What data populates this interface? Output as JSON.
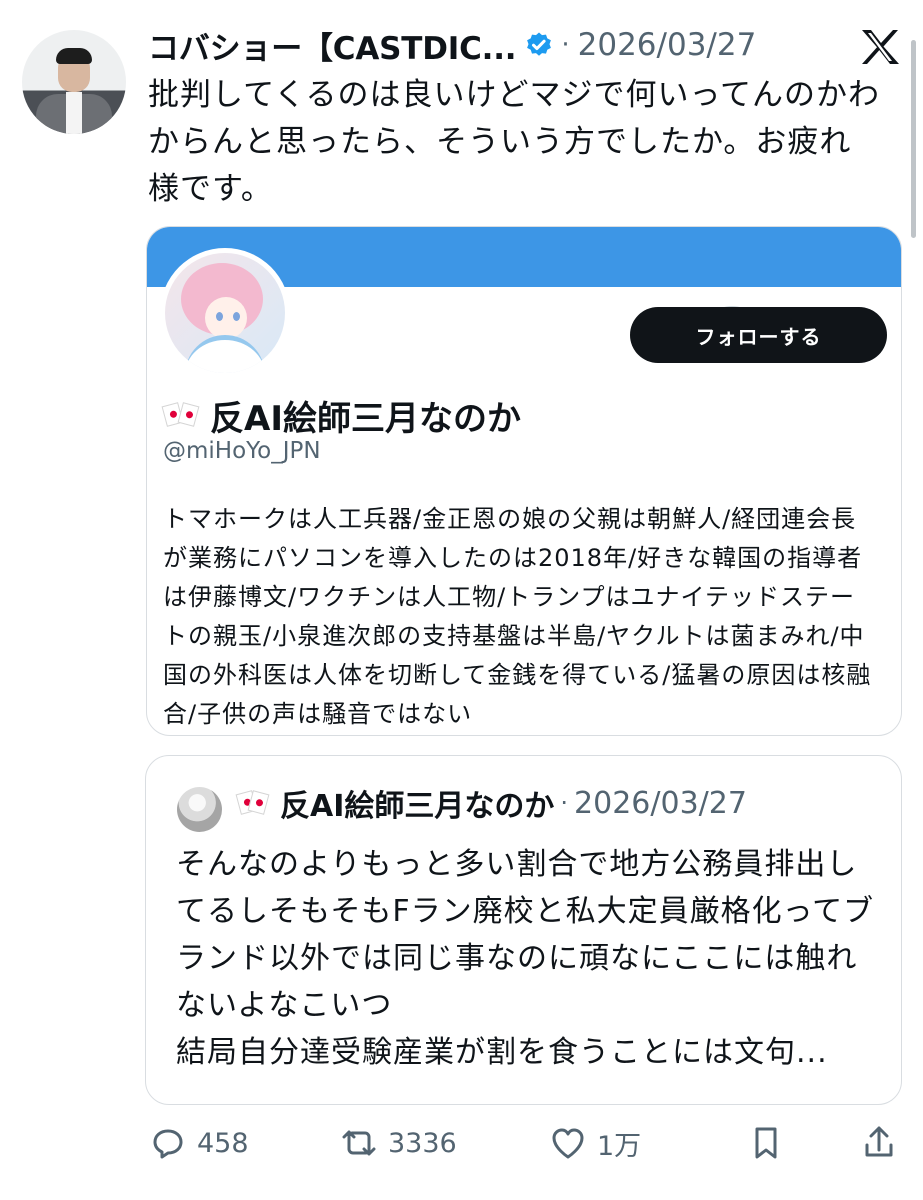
{
  "tweet": {
    "author": "コバショー【CASTDIC...",
    "separator": "·",
    "date": "2026/03/27",
    "text": "批判してくるのは良いけどマジで何いってんのかわからんと思ったら、そういう方でしたか。お疲れ様です。"
  },
  "profile_card": {
    "follow_label": "フォローする",
    "name": "反AI絵師三月なのか",
    "handle": "@miHoYo_JPN",
    "bio": "トマホークは人工兵器/金正恩の娘の父親は朝鮮人/経団連会長が業務にパソコンを導入したのは2018年/好きな韓国の指導者は伊藤博文/ワクチンは人工物/トランプはユナイテッドステートの親玉/小泉進次郎の支持基盤は半島/ヤクルトは菌まみれ/中国の外科医は人体を切断して金銭を得ている/猛暑の原因は核融合/子供の声は騒音ではない"
  },
  "quote": {
    "name": "反AI絵師三月なのか",
    "separator": "·",
    "date": "2026/03/27",
    "text": "そんなのよりもっと多い割合で地方公務員排出してるしそもそもFラン廃校と私大定員厳格化ってブランド以外では同じ事なのに頑なにここには触れないよなこいつ\n結局自分達受験産業が割を食うことには文句..."
  },
  "actions": {
    "reply_count": "458",
    "repost_count": "3336",
    "like_count": "1万"
  },
  "icons": {
    "verified": "verified-badge-icon",
    "platform": "x-logo-icon",
    "gift": "gift-icon",
    "reply": "reply-icon",
    "repost": "repost-icon",
    "like": "heart-icon",
    "bookmark": "bookmark-icon",
    "share": "share-icon"
  },
  "colors": {
    "accent": "#1d9bf0",
    "banner": "#3d96e6",
    "text": "#0f1419",
    "muted": "#536471"
  }
}
